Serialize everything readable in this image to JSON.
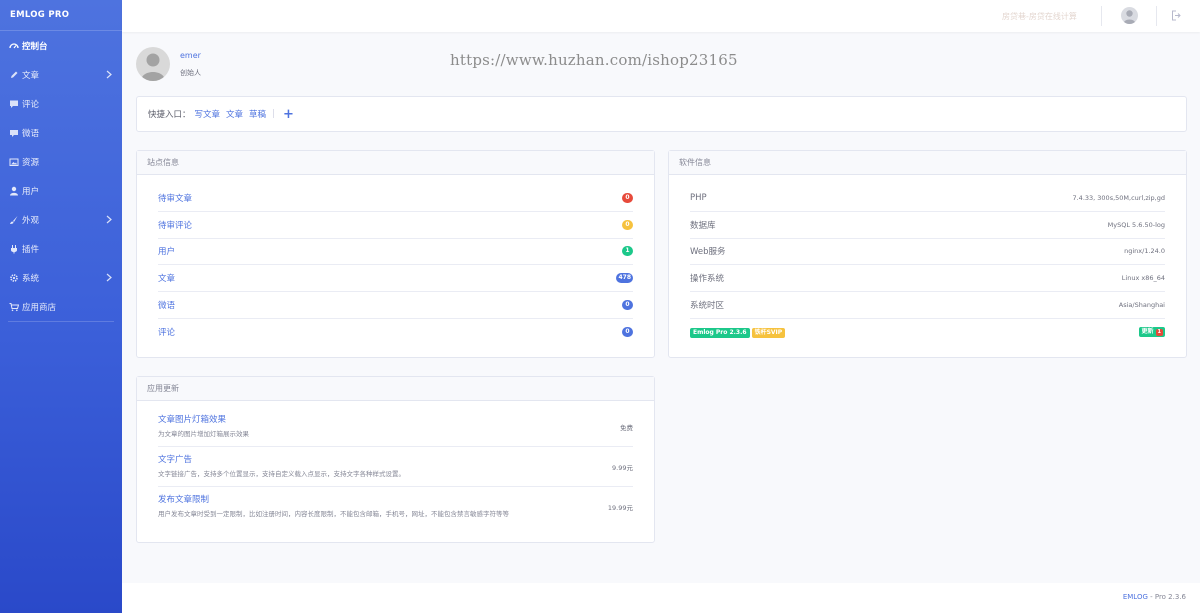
{
  "brand": "EMLOG PRO",
  "sidebar": {
    "items": [
      {
        "label": "控制台",
        "icon": "dashboard-icon"
      },
      {
        "label": "文章",
        "icon": "pen-icon",
        "chevron": true
      },
      {
        "label": "评论",
        "icon": "comment-icon"
      },
      {
        "label": "微语",
        "icon": "note-icon"
      },
      {
        "label": "资源",
        "icon": "image-icon"
      },
      {
        "label": "用户",
        "icon": "user-icon"
      },
      {
        "label": "外观",
        "icon": "brush-icon",
        "chevron": true
      },
      {
        "label": "插件",
        "icon": "plug-icon"
      },
      {
        "label": "系统",
        "icon": "gear-icon",
        "chevron": true
      },
      {
        "label": "应用商店",
        "icon": "cart-icon"
      }
    ]
  },
  "topbar": {
    "link": "房贷巷-房贷在线计算"
  },
  "profile": {
    "name": "emer",
    "role": "创始人"
  },
  "watermark": "https://www.huzhan.com/ishop23165",
  "quick": {
    "label": "快捷入口：",
    "links": [
      "写文章",
      "文章",
      "草稿"
    ],
    "plus": "+"
  },
  "site_info": {
    "title": "站点信息",
    "rows": [
      {
        "label": "待审文章",
        "count": "0",
        "color": "#e74a3b"
      },
      {
        "label": "待审评论",
        "count": "0",
        "color": "#f6c23e"
      },
      {
        "label": "用户",
        "count": "1",
        "color": "#1cc88a"
      },
      {
        "label": "文章",
        "count": "478",
        "color": "#4e73df"
      },
      {
        "label": "微语",
        "count": "0",
        "color": "#4e73df"
      },
      {
        "label": "评论",
        "count": "0",
        "color": "#4e73df"
      }
    ]
  },
  "software_info": {
    "title": "软件信息",
    "rows": [
      {
        "label": "PHP",
        "value": "7.4.33, 300s,50M,curl,zip,gd"
      },
      {
        "label": "数据库",
        "value": "MySQL 5.6.50-log"
      },
      {
        "label": "Web服务",
        "value": "nginx/1.24.0"
      },
      {
        "label": "操作系统",
        "value": "Linux x86_64"
      },
      {
        "label": "系统时区",
        "value": "Asia/Shanghai"
      }
    ],
    "version_tag": "Emlog Pro 2.3.6",
    "svip_tag": "铁杆SVIP",
    "update_label": "更新",
    "update_count": "1"
  },
  "app_updates": {
    "title": "应用更新",
    "items": [
      {
        "title": "文章图片灯箱效果",
        "desc": "为文章的图片增加灯箱展示效果",
        "price": "免费"
      },
      {
        "title": "文字广告",
        "desc": "文字链接广告，支持多个位置显示，支持自定义载入点显示，支持文字各种样式设置。",
        "price": "9.99元"
      },
      {
        "title": "发布文章限制",
        "desc": "用户发布文章时受到一定限制，比如注册时间，内容长度限制，不能包含邮箱，手机号，网址，不能包含禁言敏感字符等等",
        "price": "19.99元"
      }
    ]
  },
  "footer": {
    "brand": "EMLOG",
    "rest": " - Pro 2.3.6"
  },
  "colors": {
    "primary": "#4e73df",
    "success": "#1cc88a",
    "warning": "#f6c23e",
    "danger": "#e74a3b"
  }
}
